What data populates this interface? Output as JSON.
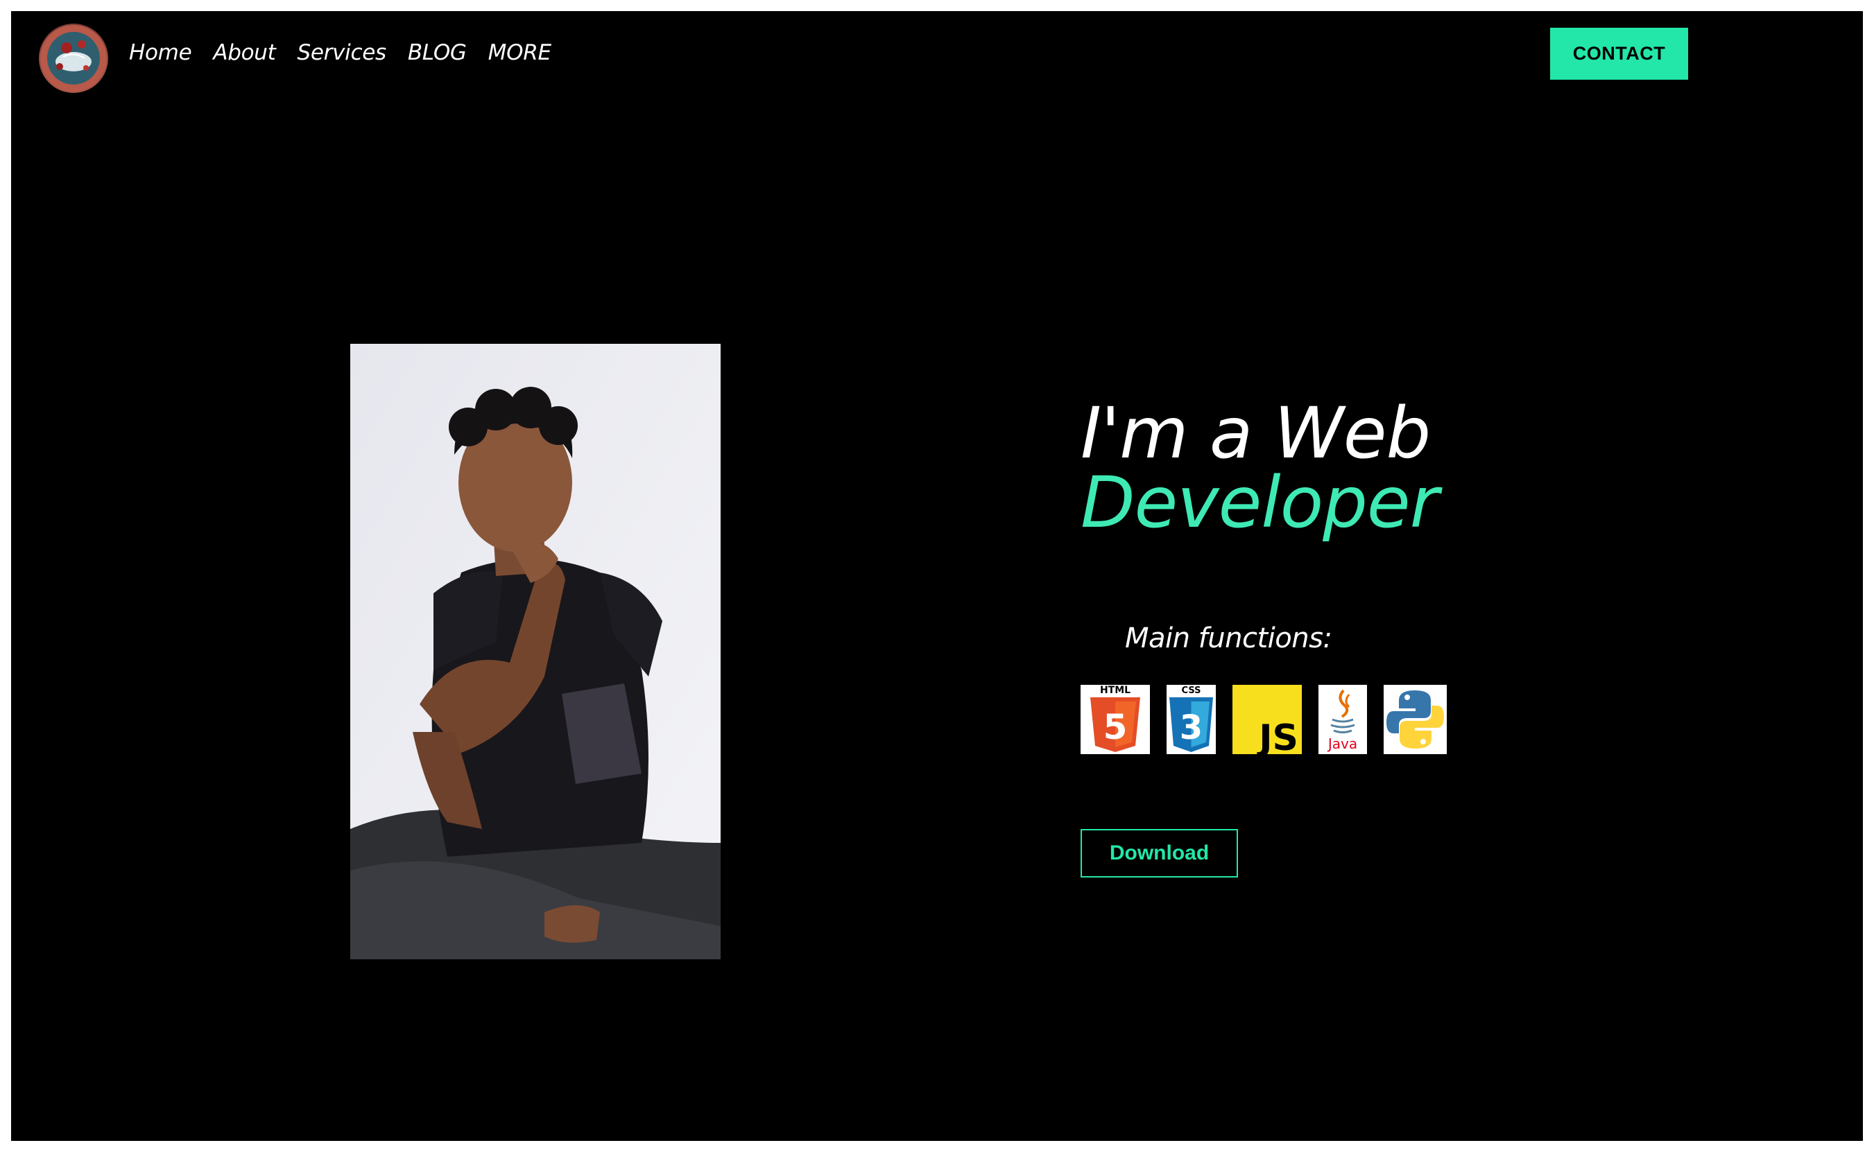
{
  "header": {
    "logo_icon": "avatar-logo-icon",
    "nav": [
      {
        "label": "Home"
      },
      {
        "label": "About"
      },
      {
        "label": "Services"
      },
      {
        "label": "BLOG"
      },
      {
        "label": "MORE"
      }
    ],
    "contact_label": "CONTACT"
  },
  "hero": {
    "headline_line1": "I'm a Web",
    "headline_line2": "Developer",
    "functions_label": "Main functions:",
    "tech_icons": [
      {
        "name": "html5-icon",
        "banner": "HTML",
        "digit": "5"
      },
      {
        "name": "css3-icon",
        "banner": "CSS",
        "digit": "3"
      },
      {
        "name": "javascript-icon",
        "text": "JS"
      },
      {
        "name": "java-icon",
        "text": "Java"
      },
      {
        "name": "python-icon"
      }
    ],
    "download_label": "Download"
  },
  "colors": {
    "background": "#000000",
    "accent": "#23e7a8",
    "headline_accent": "#3ee9b4",
    "text": "#ffffff"
  }
}
